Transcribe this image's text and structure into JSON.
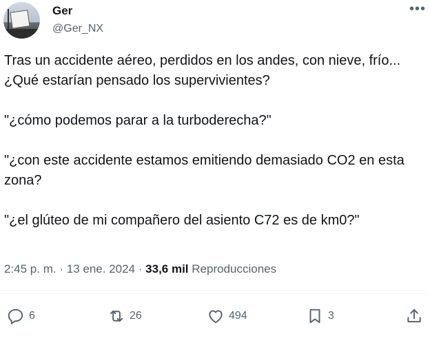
{
  "author": {
    "display_name": "Ger",
    "handle": "@Ger_NX",
    "avatar_icon": "user-avatar-photo"
  },
  "menu_icon": "ellipsis-icon",
  "tweet": {
    "lines": [
      "Tras un accidente aéreo, perdidos en los andes, con nieve, frío... ¿Qué estarían pensado los supervivientes?",
      "\"¿cómo podemos parar a la turboderecha?\"",
      "\"¿con este accidente estamos emitiendo demasiado CO2 en esta zona?",
      "\"¿el glúteo de mi compañero del asiento C72 es de km0?\""
    ]
  },
  "meta": {
    "time": "2:45 p. m.",
    "separator": "·",
    "date": "13 ene. 2024",
    "views_count": "33,6 mil",
    "views_label": "Reproducciones"
  },
  "actions": {
    "replies": "6",
    "reposts": "26",
    "likes": "494",
    "bookmarks": "3"
  },
  "colors": {
    "text": "#0f1419",
    "secondary": "#536471",
    "divider": "#eff3f4"
  }
}
